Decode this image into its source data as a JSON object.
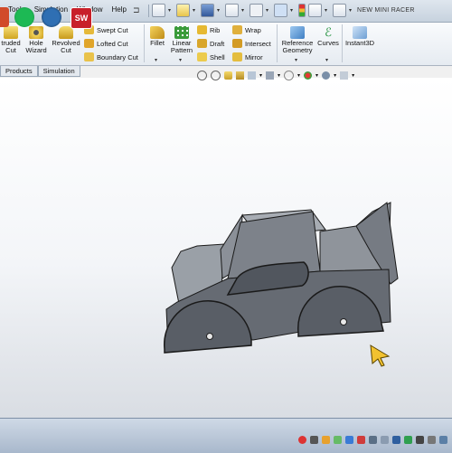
{
  "window": {
    "document_title": "NEW MINI RACER"
  },
  "menu": [
    "Tools",
    "Simulation",
    "Window",
    "Help"
  ],
  "ribbon": {
    "extruded_cut_l1": "truded",
    "extruded_cut_l2": "Cut",
    "hole_wizard_l1": "Hole",
    "hole_wizard_l2": "Wizard",
    "revolved_cut_l1": "Revolved",
    "revolved_cut_l2": "Cut",
    "swept_cut": "Swept Cut",
    "lofted_cut": "Lofted Cut",
    "boundary_cut": "Boundary Cut",
    "fillet": "Fillet",
    "linear_pattern_l1": "Linear",
    "linear_pattern_l2": "Pattern",
    "rib": "Rib",
    "draft": "Draft",
    "shell": "Shell",
    "wrap": "Wrap",
    "intersect": "Intersect",
    "mirror": "Mirror",
    "reference_geometry_l1": "Reference",
    "reference_geometry_l2": "Geometry",
    "curves": "Curves",
    "instant3d": "Instant3D"
  },
  "tabs": [
    "Products",
    "Simulation"
  ],
  "colors": {
    "body_top": "#9ea3aa",
    "body_side": "#6f747c",
    "edge": "#1a1a1a",
    "accent_yellow": "#f2c230"
  },
  "taskbar_icons": [
    "spotify-icon",
    "mathworks-icon",
    "solidworks-icon"
  ],
  "taskbar_sw_label": "SW"
}
